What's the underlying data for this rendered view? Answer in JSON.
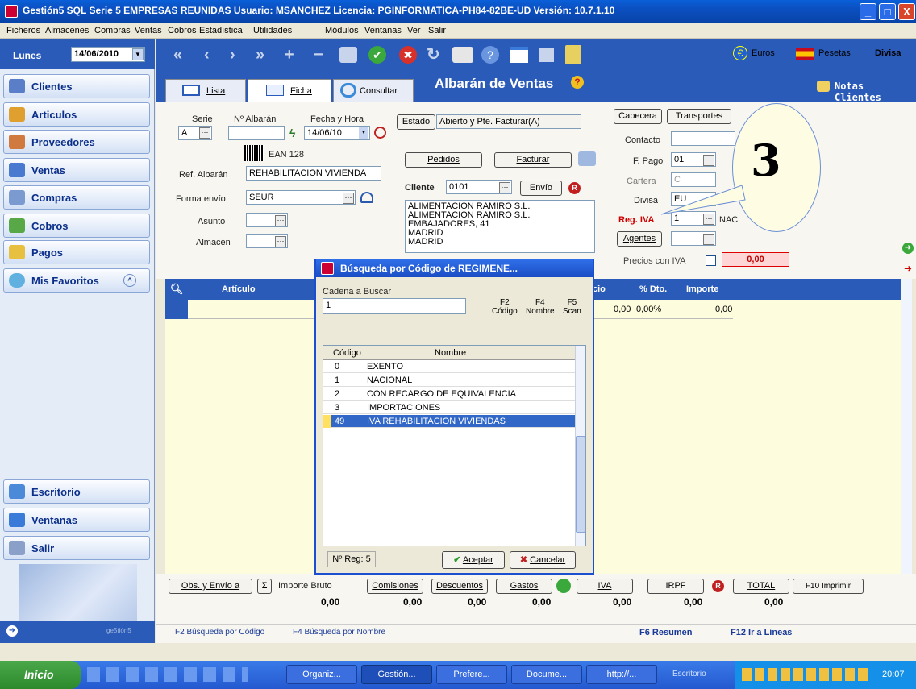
{
  "titlebar": {
    "title": "Gestión5 SQL Serie 5  EMPRESAS REUNIDAS    Usuario: MSANCHEZ     Licencia: PGINFORMATICA-PH84-82BE-UD       Versión: 10.7.1.10",
    "min": "_",
    "max": "□",
    "close": "X"
  },
  "menu": {
    "items": [
      "Ficheros",
      "Almacenes",
      "Compras",
      "Ventas",
      "Cobros",
      "Estadística",
      "Utilidades",
      "|",
      "Módulos",
      "Ventanas",
      "Ver",
      "Salir"
    ]
  },
  "side": {
    "day": "Lunes",
    "date": "14/06/2010",
    "items": [
      "Clientes",
      "Articulos",
      "Proveedores",
      "Ventas",
      "Compras",
      "Cobros",
      "Pagos",
      "Mis Favoritos"
    ],
    "bottom_items": [
      "Escritorio",
      "Ventanas",
      "Salir"
    ],
    "logo_text": "ge5tión5"
  },
  "toolbar": {
    "euros": "Euros",
    "pesetas": "Pesetas",
    "divisa": "Divisa"
  },
  "tabs": {
    "lista": "Lista",
    "ficha": "Ficha",
    "consultar": "Consultar",
    "title": "Albarán de Ventas",
    "help": "?",
    "notas": "Notas Clientes"
  },
  "form": {
    "serie_label": "Serie",
    "serie_value": "A",
    "num_label": "Nº Albarán",
    "num_value": "",
    "fecha_label": "Fecha y Hora",
    "fecha_value": "14/06/10",
    "ean": "EAN 128",
    "ref_label": "Ref. Albarán",
    "ref_value": "REHABILITACION VIVIENDA",
    "envio_label": "Forma envío",
    "envio_value": "SEUR",
    "asunto_label": "Asunto",
    "almacen_label": "Almacén",
    "estado_label": "Estado",
    "estado_value": "Abierto y Pte. Facturar(A)",
    "pedidos": "Pedidos",
    "facturar": "Facturar",
    "cliente_label": "Cliente",
    "cliente_value": "0101",
    "envio_btn": "Envío",
    "address": [
      "ALIMENTACION RAMIRO  S.L.",
      "ALIMENTACION RAMIRO S.L.",
      "EMBAJADORES, 41",
      "MADRID",
      "MADRID"
    ],
    "cabecera": "Cabecera",
    "transportes": "Transportes",
    "contacto_label": "Contacto",
    "fpago_label": "F. Pago",
    "fpago_value": "01",
    "cartera_label": "Cartera",
    "cartera_value": "C",
    "divisa_label": "Divisa",
    "divisa_value": "EU",
    "regiva_label": "Reg. IVA",
    "regiva_value": "1",
    "regiva_desc": "NAC",
    "agentes": "Agentes",
    "precios_iva_label": "Precios con IVA",
    "precios_iva_value": "0,00"
  },
  "callout": {
    "number": "3"
  },
  "grid": {
    "headers": [
      "Artículo",
      "cio",
      "% Dto.",
      "Importe"
    ],
    "row": {
      "precio": "0,00",
      "dto": "0,00%",
      "importe": "0,00"
    }
  },
  "dialog": {
    "title": "Búsqueda por Código de REGIMENE...",
    "search_label": "Cadena a Buscar",
    "search_value": "1",
    "f2": "F2",
    "f2_sub": "Código",
    "f4": "F4",
    "f4_sub": "Nombre",
    "f5": "F5",
    "f5_sub": "Scan",
    "col_code": "Código",
    "col_name": "Nombre",
    "rows": [
      {
        "code": "0",
        "name": "EXENTO"
      },
      {
        "code": "1",
        "name": "NACIONAL"
      },
      {
        "code": "2",
        "name": "CON RECARGO DE EQUIVALENCIA"
      },
      {
        "code": "3",
        "name": "IMPORTACIONES"
      },
      {
        "code": "49",
        "name": "IVA REHABILITACION VIVIENDAS"
      }
    ],
    "nreg": "Nº Reg: 5",
    "accept": "Aceptar",
    "cancel": "Cancelar"
  },
  "bottom": {
    "obs": "Obs. y Envío a",
    "sigma": "Σ",
    "bruto": "Importe Bruto",
    "comisiones": "Comisiones",
    "descuentos": "Descuentos",
    "gastos": "Gastos",
    "iva": "IVA",
    "irpf": "IRPF",
    "total": "TOTAL",
    "imprimir": "F10 Imprimir",
    "values": [
      "0,00",
      "0,00",
      "0,00",
      "0,00",
      "0,00",
      "0,00",
      "0,00"
    ]
  },
  "status": {
    "f2": "F2 Búsqueda por Código",
    "f4": "F4 Búsqueda por Nombre",
    "f6": "F6 Resumen",
    "f12": "F12 Ir a Líneas"
  },
  "taskbar": {
    "start": "Inicio",
    "tasks": [
      "Organiz...",
      "Gestión...",
      "Prefere...",
      "Docume...",
      "http://..."
    ],
    "escritorio": "Escritorio",
    "time": "20:07"
  },
  "colors": {
    "accent": "#2b5bb8",
    "selected": "#3168c8",
    "regiva": "#d00000",
    "importe": "#c00000"
  }
}
